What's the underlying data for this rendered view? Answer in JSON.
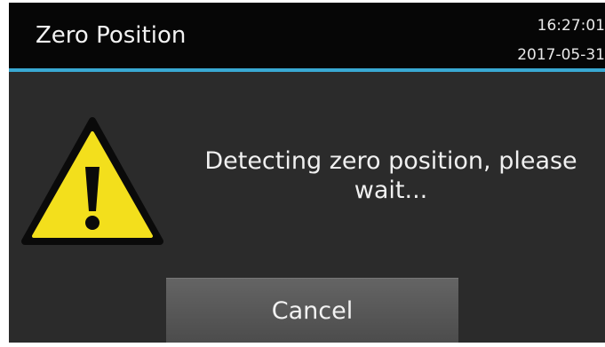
{
  "header": {
    "title": "Zero Position",
    "time": "16:27:01",
    "date": "2017-05-31",
    "accent_color": "#39a9d3"
  },
  "dialog": {
    "icon": "warning-icon",
    "icon_color": "#f3df1c",
    "message": "Detecting zero position, please wait..."
  },
  "buttons": {
    "cancel_label": "Cancel"
  }
}
